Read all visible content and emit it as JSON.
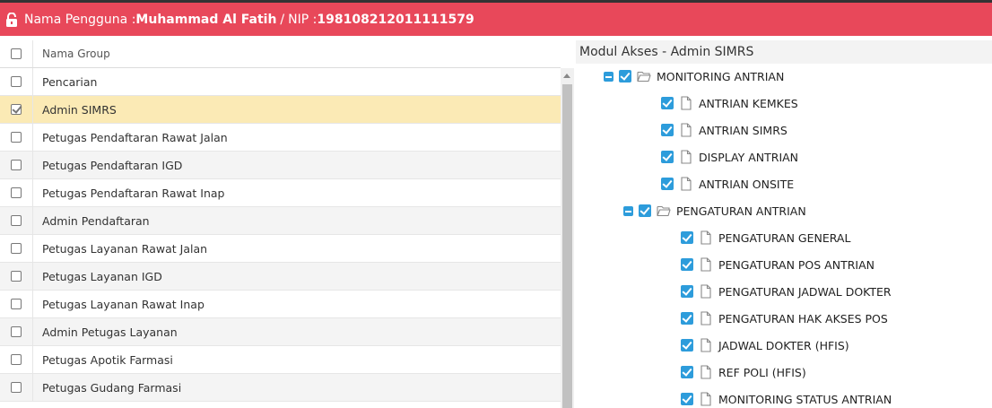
{
  "header": {
    "user_label": "Nama Pengguna : ",
    "user_name": "Muhammad Al Fatih",
    "nip_label": "NIP : ",
    "nip_value": "198108212011111579",
    "separator": "/"
  },
  "colors": {
    "header_bg": "#e8485a",
    "selected_row": "#fbeab5",
    "tree_check": "#2d9cdb"
  },
  "left_table": {
    "column_header": "Nama Group",
    "rows": [
      {
        "label": "Pencarian",
        "checked": false
      },
      {
        "label": "Admin SIMRS",
        "checked": true
      },
      {
        "label": "Petugas Pendaftaran Rawat Jalan",
        "checked": false
      },
      {
        "label": "Petugas Pendaftaran IGD",
        "checked": false
      },
      {
        "label": "Petugas Pendaftaran Rawat Inap",
        "checked": false
      },
      {
        "label": "Admin Pendaftaran",
        "checked": false
      },
      {
        "label": "Petugas Layanan Rawat Jalan",
        "checked": false
      },
      {
        "label": "Petugas Layanan IGD",
        "checked": false
      },
      {
        "label": "Petugas Layanan Rawat Inap",
        "checked": false
      },
      {
        "label": "Admin Petugas Layanan",
        "checked": false
      },
      {
        "label": "Petugas Apotik Farmasi",
        "checked": false
      },
      {
        "label": "Petugas Gudang Farmasi",
        "checked": false
      }
    ]
  },
  "right_panel": {
    "title": "Modul Akses - Admin SIMRS",
    "tree": [
      {
        "label": "MONITORING ANTRIAN",
        "level": 0,
        "folder": true
      },
      {
        "label": "ANTRIAN KEMKES",
        "level": 1,
        "folder": false
      },
      {
        "label": "ANTRIAN SIMRS",
        "level": 1,
        "folder": false
      },
      {
        "label": "DISPLAY ANTRIAN",
        "level": 1,
        "folder": false
      },
      {
        "label": "ANTRIAN ONSITE",
        "level": 1,
        "folder": false
      },
      {
        "label": "PENGATURAN ANTRIAN",
        "level": 1,
        "folder": true
      },
      {
        "label": "PENGATURAN GENERAL",
        "level": 2,
        "folder": false
      },
      {
        "label": "PENGATURAN POS ANTRIAN",
        "level": 2,
        "folder": false
      },
      {
        "label": "PENGATURAN JADWAL DOKTER",
        "level": 2,
        "folder": false
      },
      {
        "label": "PENGATURAN HAK AKSES POS",
        "level": 2,
        "folder": false
      },
      {
        "label": "JADWAL DOKTER (HFIS)",
        "level": 2,
        "folder": false
      },
      {
        "label": "REF POLI (HFIS)",
        "level": 2,
        "folder": false
      },
      {
        "label": "MONITORING STATUS ANTRIAN",
        "level": 2,
        "folder": false
      }
    ]
  }
}
